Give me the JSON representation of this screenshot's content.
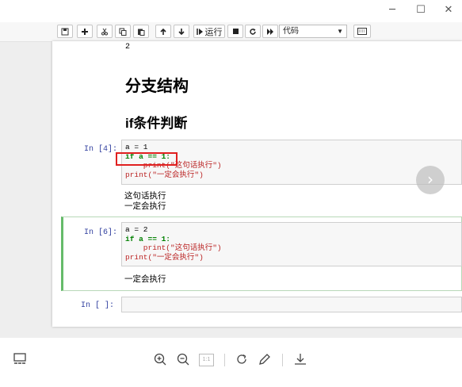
{
  "window": {
    "minimize": "─",
    "maximize": "☐",
    "close": "✕"
  },
  "toolbar": {
    "run_label": "运行",
    "cell_type": "代码",
    "icons": [
      "save-icon",
      "plus-icon",
      "cut-icon",
      "copy-icon",
      "paste-icon",
      "arrow-up-icon",
      "arrow-down-icon",
      "run-icon",
      "stop-icon",
      "restart-icon",
      "fast-forward-icon",
      "keyboard-icon"
    ]
  },
  "notebook": {
    "prev_output": "2",
    "heading2": "分支结构",
    "heading3": "if条件判断",
    "cell1": {
      "prompt": "In  [4]:",
      "lines": [
        "a = 1",
        "if a == 1:",
        "    print(\"这句话执行\")",
        "print(\"一定会执行\")"
      ],
      "output": [
        "这句话执行",
        "一定会执行"
      ]
    },
    "cell2": {
      "prompt": "In  [6]:",
      "lines": [
        "a = 2",
        "if a == 1:",
        "    print(\"这句话执行\")",
        "print(\"一定会执行\")"
      ],
      "output": [
        "一定会执行"
      ]
    },
    "cell3": {
      "prompt": "In  [ ]:"
    }
  },
  "viewer": {
    "next_icon": "›",
    "page_indicator": "1:1"
  },
  "colors": {
    "highlight": "#e02020",
    "selected_cell": "#66bb6a",
    "prompt": "#303f9f",
    "keyword": "#008000",
    "string": "#ba2121"
  }
}
